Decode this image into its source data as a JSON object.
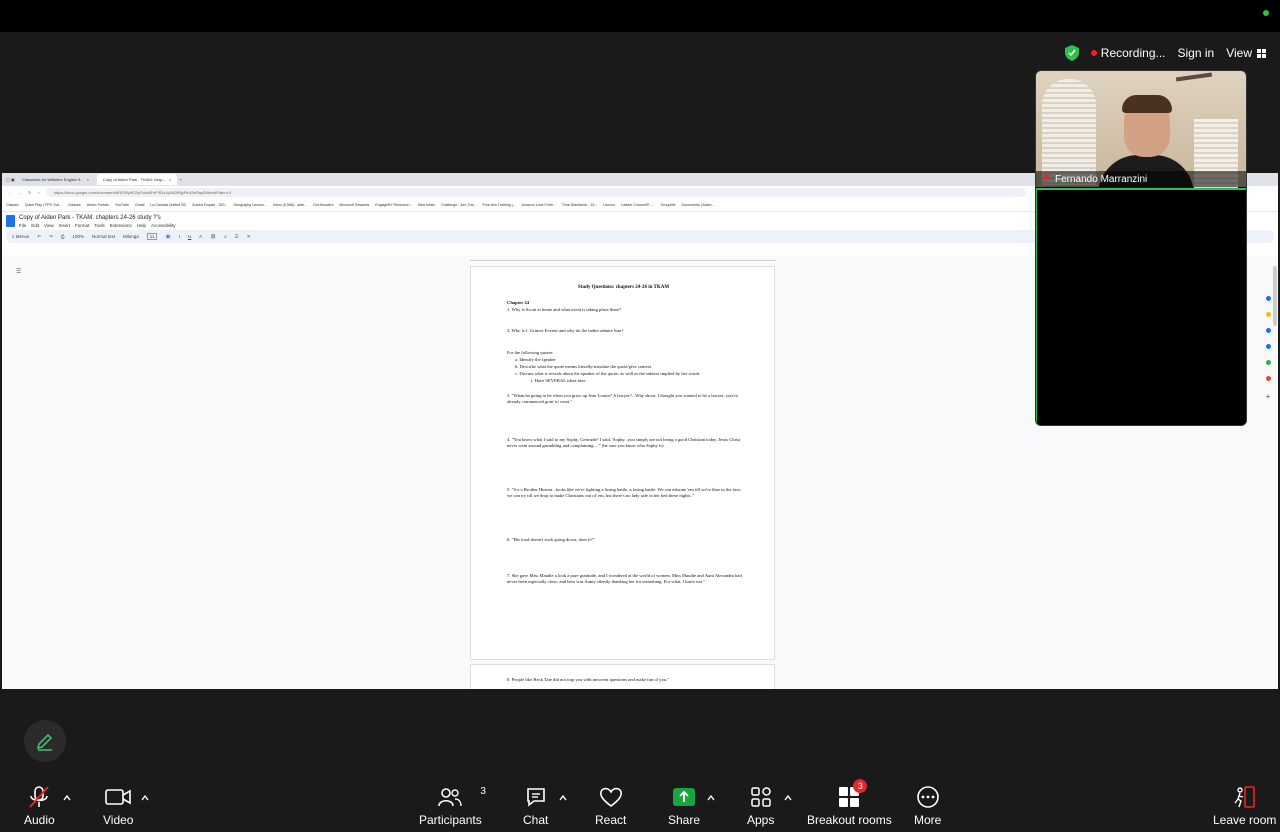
{
  "zoom": {
    "recording_label": "Recording...",
    "sign_in_label": "Sign in",
    "view_label": "View",
    "participant_name": "Fernando Marranzini",
    "toolbar": {
      "audio": "Audio",
      "video": "Video",
      "participants": "Participants",
      "participants_count": "3",
      "chat": "Chat",
      "react": "React",
      "share": "Share",
      "apps": "Apps",
      "breakout": "Breakout rooms",
      "breakout_badge": "3",
      "more": "More",
      "leave": "Leave room"
    },
    "colors": {
      "share_green": "#19a442",
      "badge_red": "#e02828",
      "active_border": "#2fbf4a"
    }
  },
  "browser": {
    "tabs": [
      "Classwork for Wiltshire English 9...",
      "Copy of Aiden Park - TKAM: chap..."
    ],
    "url": "https://docs.google.com/document/d/1Gf9y9G2yFc4u8FeFXDx1y5A2ff3jyFeUSeSay2tA/edit?tab=t.0",
    "bookmarks": [
      "Classes",
      "Quick Play | FPS Trai...",
      "Classes",
      "Aimex Portals",
      "YouTube",
      "Gmail",
      "La Canada Unified SD",
      "Zombs Royale - 300...",
      "Geography Lesson...",
      "Inbox (5,558) - aide...",
      "Get Answers",
      "Microsoft Rewards",
      "EngageNY Resource...",
      "New folder",
      "Challenge - Aim Trai...",
      "Free Aim Training |...",
      "Amazon Luxe Fortn...",
      "Time Standards - 15...",
      "Lenovo",
      "Ladder Connect® -...",
      "GroupMe",
      "Documents | Aiden..."
    ]
  },
  "doc": {
    "title": "Copy of Aiden Park - TKAM: chapters 24-26 study ?'s",
    "menus": [
      "File",
      "Edit",
      "View",
      "Insert",
      "Format",
      "Tools",
      "Extensions",
      "Help",
      "Accessibility"
    ],
    "toolbar": {
      "menus_label": "Menus",
      "zoom": "100%",
      "style": "Normal text",
      "font": "Milonga",
      "size": "11"
    },
    "heading": "Study Questions: chapters 24-26 in TKAM",
    "chapter": "Chapter 24",
    "q1": "1.  Why is Scout at home and what event is taking place there?",
    "q2": "2.  Who is J. Grimes Everett and why do the ladies admire him?",
    "quotes_intro": "For the following quotes:",
    "quote_a": "a.    Identify the speaker",
    "quote_b": "b.    Describe what the quote means literally/translate the quote/give context",
    "quote_c": "c.    Discuss what it reveals about the speaker of the quote, as well as the subtext implied by her words",
    "quote_i": "i.      Have SEVERAL ideas here",
    "q3": "3.  \"Whatcha going to be when you grow up Jean Louise? A lawyer?...Why shoot, I thought you wanted to be a lawyer, you've already commenced goin' to court.\"",
    "q4": "4.  \"You know what I said to my Sophy, Gertrude?  I said, 'Sophy...you simply are not being a good Christian today.  Jesus Christ never went around grumbling and complaining....'\" (be sure you know who Sophy is)",
    "q5": "5.  \"S-s-s Brother Hutson...looks like we're fighting a losing battle, a losing battle.  We can educate 'em till we're blue in the face, we can try till we drop to make Christians out of' em, but there's no lady safe in her bed these nights.\"",
    "q6": "6.  \"His food doesn't stick going down, does it?\"",
    "q7": "7.  She gave Miss Maudie a look a pure gratitude, and I wondered at the world of women.  Miss Maudie and Aunt Alexandra had never been especially close, and here was Aunty silently thanking her for something.  For what, I knew not.\"",
    "q8": "8.  People like Heck Tate did not trap you with innocent questions and make fun of you.\""
  }
}
